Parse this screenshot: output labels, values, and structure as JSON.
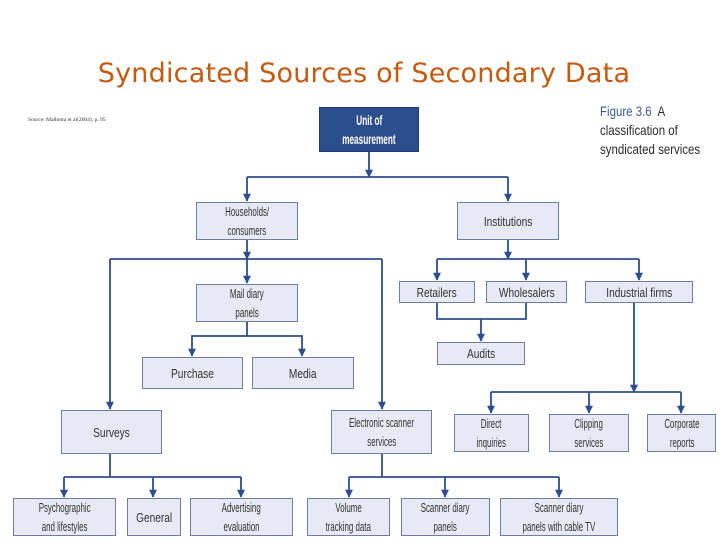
{
  "title": "Syndicated Sources of Secondary Data",
  "source_note": "Source: Malhotra et al(2004), p. 95",
  "caption": {
    "figure_label": "Figure 3.6",
    "line1_rest": "A",
    "line2": "classification of",
    "line3": "syndicated services"
  },
  "colors": {
    "title": "#C55A11",
    "root_fill": "#2d4e8e",
    "node_fill": "#e7e9f4",
    "connector": "#2d4e8e"
  },
  "nodes": {
    "root": {
      "line1": "Unit of",
      "line2": "measurement"
    },
    "households": {
      "line1": "Households/",
      "line2": "consumers"
    },
    "institutions": {
      "line1": "Institutions"
    },
    "mail_diary": {
      "line1": "Mail diary",
      "line2": "panels"
    },
    "purchase": {
      "line1": "Purchase"
    },
    "media": {
      "line1": "Media"
    },
    "surveys": {
      "line1": "Surveys"
    },
    "electronic_scanner": {
      "line1": "Electronic scanner",
      "line2": "services"
    },
    "retailers": {
      "line1": "Retailers"
    },
    "wholesalers": {
      "line1": "Wholesalers"
    },
    "industrial_firms": {
      "line1": "Industrial firms"
    },
    "audits": {
      "line1": "Audits"
    },
    "direct_inquiries": {
      "line1": "Direct",
      "line2": "inquiries"
    },
    "clipping_services": {
      "line1": "Clipping",
      "line2": "services"
    },
    "corporate_reports": {
      "line1": "Corporate",
      "line2": "reports"
    },
    "psychographic": {
      "line1": "Psychographic",
      "line2": "and lifestyles"
    },
    "general": {
      "line1": "General"
    },
    "advertising": {
      "line1": "Advertising",
      "line2": "evaluation"
    },
    "volume_tracking": {
      "line1": "Volume",
      "line2": "tracking data"
    },
    "scanner_diary": {
      "line1": "Scanner diary",
      "line2": "panels"
    },
    "scanner_cable": {
      "line1": "Scanner diary",
      "line2": "panels with cable TV"
    }
  },
  "edges": [
    [
      "root",
      "households"
    ],
    [
      "root",
      "institutions"
    ],
    [
      "households",
      "mail_diary"
    ],
    [
      "households",
      "surveys"
    ],
    [
      "households",
      "electronic_scanner"
    ],
    [
      "mail_diary",
      "purchase"
    ],
    [
      "mail_diary",
      "media"
    ],
    [
      "institutions",
      "retailers"
    ],
    [
      "institutions",
      "wholesalers"
    ],
    [
      "institutions",
      "industrial_firms"
    ],
    [
      "retailers",
      "audits"
    ],
    [
      "wholesalers",
      "audits"
    ],
    [
      "industrial_firms",
      "direct_inquiries"
    ],
    [
      "industrial_firms",
      "clipping_services"
    ],
    [
      "industrial_firms",
      "corporate_reports"
    ],
    [
      "surveys",
      "psychographic"
    ],
    [
      "surveys",
      "general"
    ],
    [
      "surveys",
      "advertising"
    ],
    [
      "electronic_scanner",
      "volume_tracking"
    ],
    [
      "electronic_scanner",
      "scanner_diary"
    ],
    [
      "electronic_scanner",
      "scanner_cable"
    ]
  ]
}
